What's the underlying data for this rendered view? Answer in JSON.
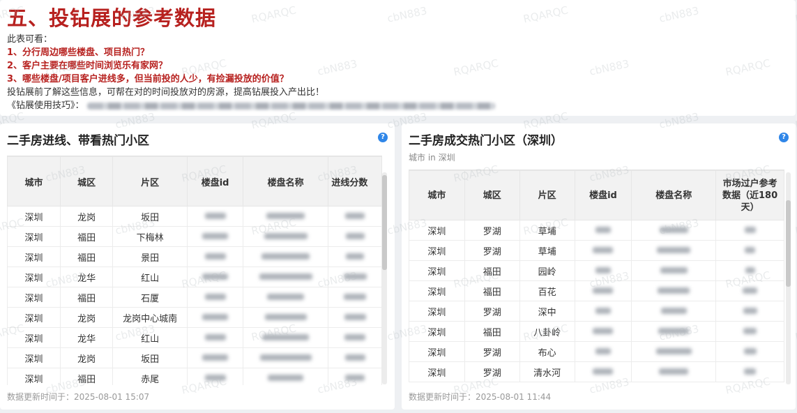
{
  "header": {
    "title": "五、投钻展的参考数据",
    "intro": "此表可看：",
    "points": [
      "1、分行周边哪些楼盘、项目热门？",
      "2、客户主要在哪些时间浏览乐有家网？",
      "3、哪些楼盘/项目客户进线多，但当前投的人少，有捡漏投放的价值？"
    ],
    "summary": "投钻展前了解这些信息，可帮在对的时间投放对的房源，提高钻展投入产出比！",
    "tips_label": "《钻展使用技巧》："
  },
  "left_panel": {
    "title": "二手房进线、带看热门小区",
    "columns": [
      "城市",
      "城区",
      "片区",
      "楼盘id",
      "楼盘名称",
      "进线分数"
    ],
    "rows": [
      {
        "city": "深圳",
        "district": "龙岗",
        "area": "坂田"
      },
      {
        "city": "深圳",
        "district": "福田",
        "area": "下梅林"
      },
      {
        "city": "深圳",
        "district": "福田",
        "area": "景田"
      },
      {
        "city": "深圳",
        "district": "龙华",
        "area": "红山"
      },
      {
        "city": "深圳",
        "district": "福田",
        "area": "石厦"
      },
      {
        "city": "深圳",
        "district": "龙岗",
        "area": "龙岗中心城南"
      },
      {
        "city": "深圳",
        "district": "龙华",
        "area": "红山"
      },
      {
        "city": "深圳",
        "district": "龙岗",
        "area": "坂田"
      },
      {
        "city": "深圳",
        "district": "福田",
        "area": "赤尾"
      }
    ],
    "footer": "数据更新时间于：2025-08-01 15:07"
  },
  "right_panel": {
    "title": "二手房成交热门小区（深圳）",
    "subtitle": "城市 in 深圳",
    "columns": [
      "城市",
      "城区",
      "片区",
      "楼盘id",
      "楼盘名称",
      "市场过户参考数据（近180天）"
    ],
    "rows": [
      {
        "city": "深圳",
        "district": "罗湖",
        "area": "草埔"
      },
      {
        "city": "深圳",
        "district": "罗湖",
        "area": "草埔"
      },
      {
        "city": "深圳",
        "district": "福田",
        "area": "园岭"
      },
      {
        "city": "深圳",
        "district": "福田",
        "area": "百花"
      },
      {
        "city": "深圳",
        "district": "罗湖",
        "area": "深中"
      },
      {
        "city": "深圳",
        "district": "福田",
        "area": "八卦岭"
      },
      {
        "city": "深圳",
        "district": "罗湖",
        "area": "布心"
      },
      {
        "city": "深圳",
        "district": "罗湖",
        "area": "清水河"
      }
    ],
    "footer": "数据更新时间于：2025-08-01 11:44"
  },
  "watermarks": [
    "RQARQC",
    "cbN883"
  ],
  "colors": {
    "accent_red": "#b7211f",
    "help_blue": "#2f86e8"
  },
  "icons": {
    "help": "question-circle-icon"
  },
  "help_glyph": "?"
}
